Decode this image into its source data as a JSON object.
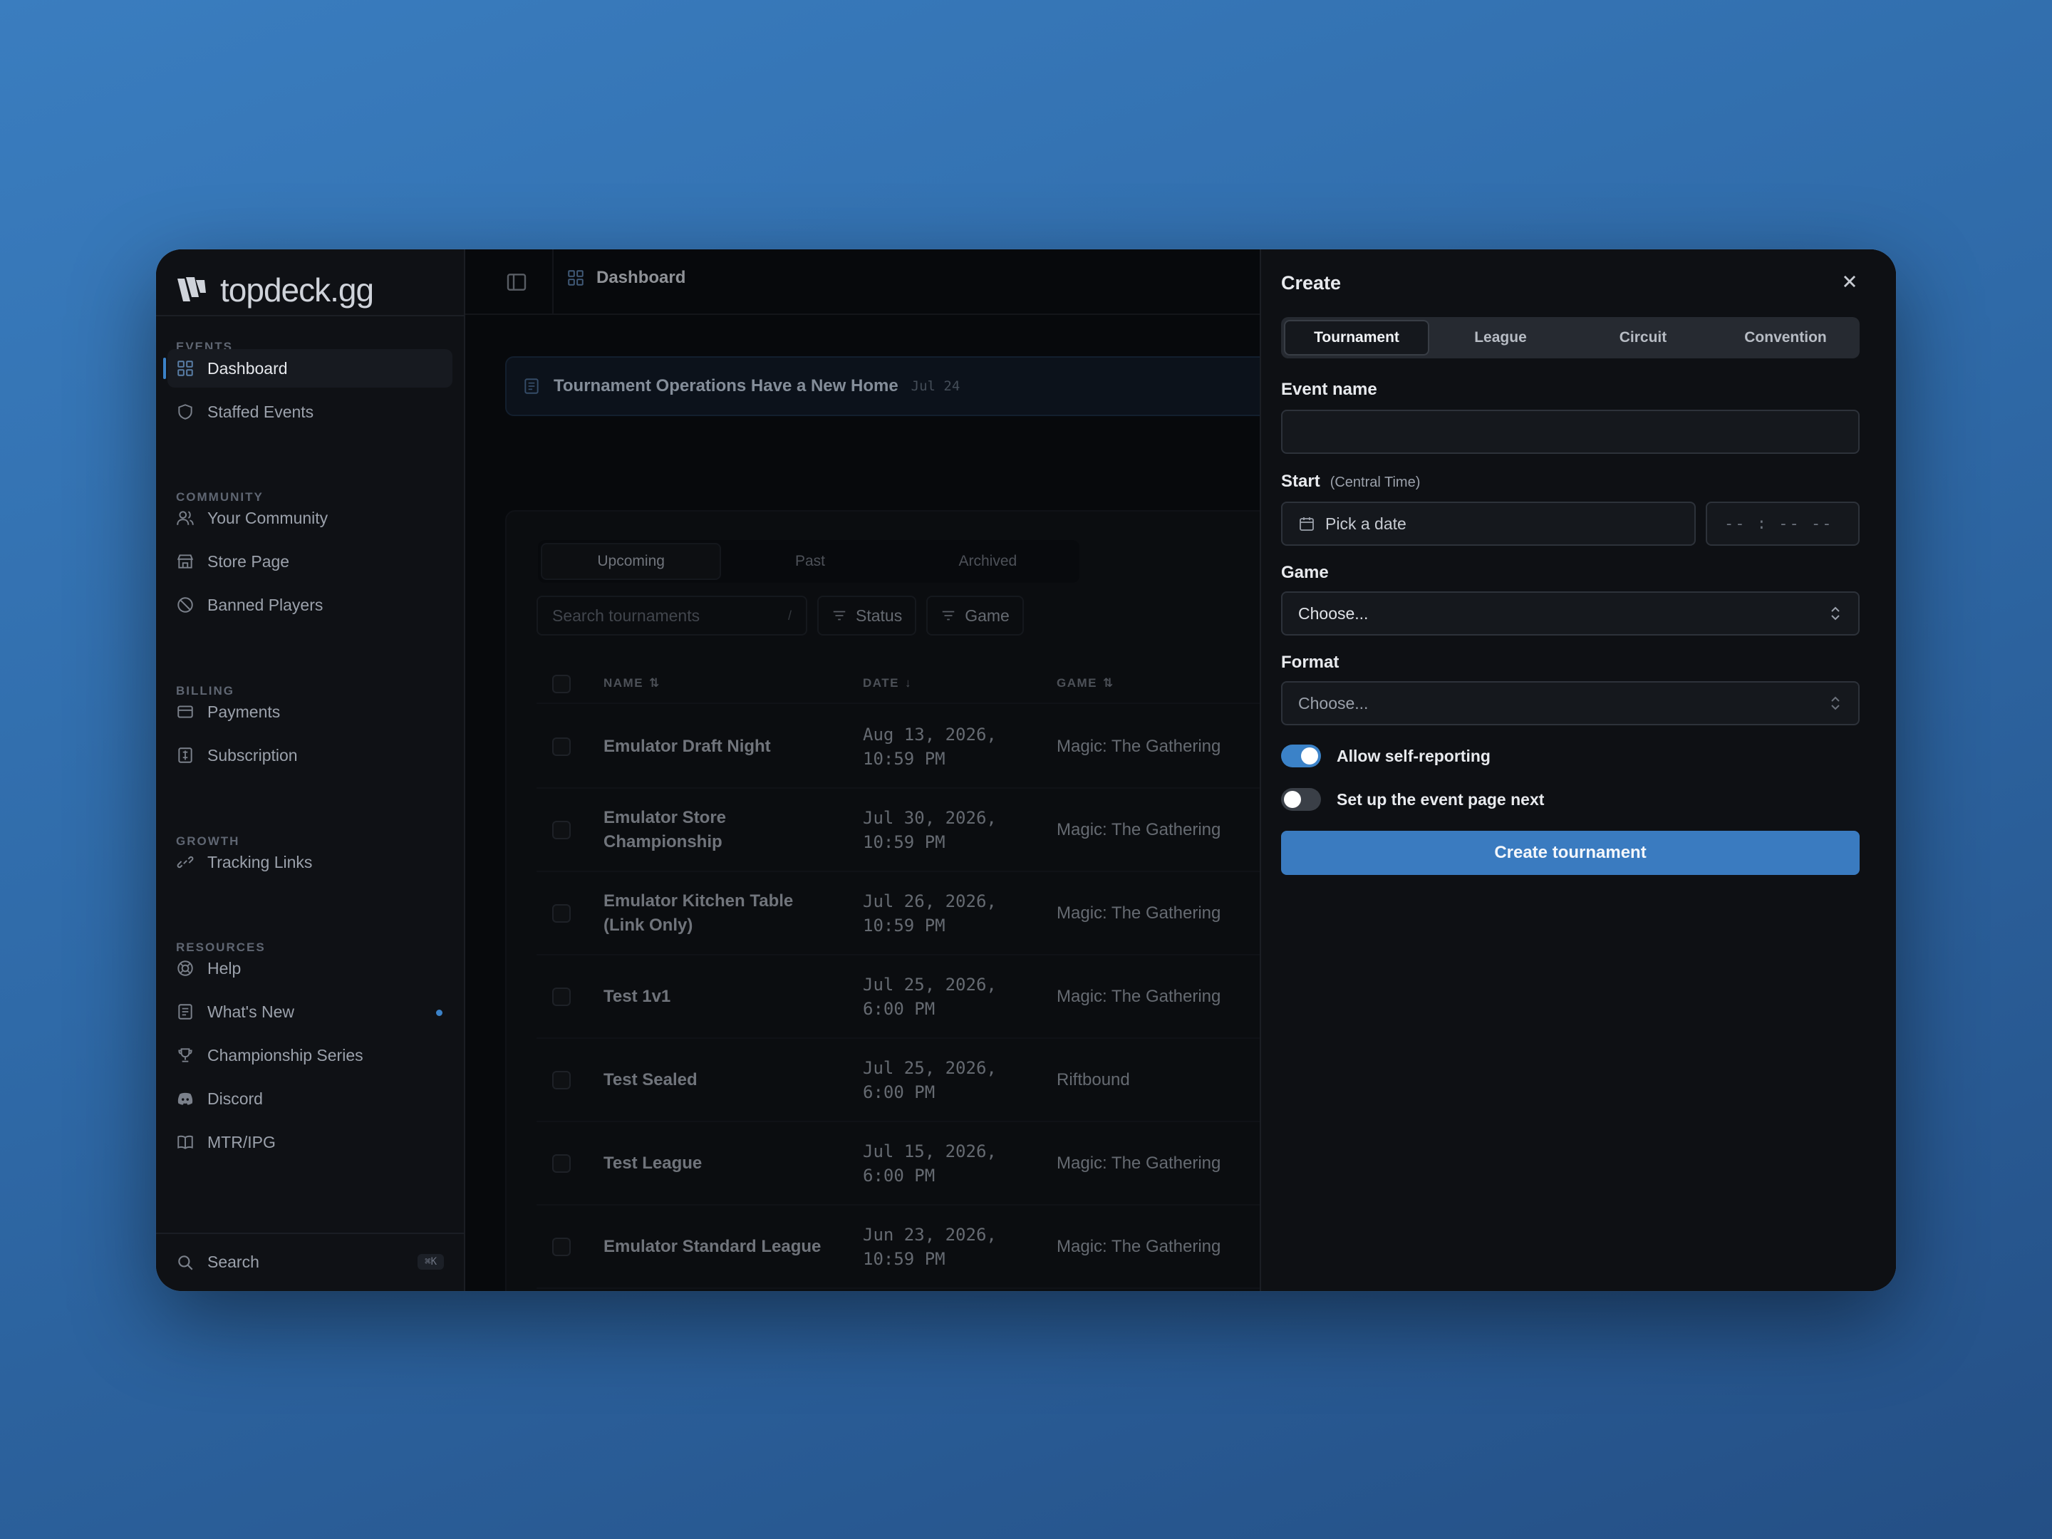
{
  "app": {
    "logo_text": "topdeck.gg"
  },
  "sidebar": {
    "sections": {
      "events": "EVENTS",
      "community": "COMMUNITY",
      "billing": "BILLING",
      "growth": "GROWTH",
      "resources": "RESOURCES"
    },
    "items": [
      {
        "label": "Dashboard",
        "icon": "grid-icon"
      },
      {
        "label": "Staffed Events",
        "icon": "shield-icon"
      },
      {
        "label": "Your Community",
        "icon": "users-icon"
      },
      {
        "label": "Store Page",
        "icon": "store-icon"
      },
      {
        "label": "Banned Players",
        "icon": "ban-icon"
      },
      {
        "label": "Payments",
        "icon": "card-icon"
      },
      {
        "label": "Subscription",
        "icon": "receipt-icon"
      },
      {
        "label": "Tracking Links",
        "icon": "link-icon"
      },
      {
        "label": "Help",
        "icon": "lifebuoy-icon"
      },
      {
        "label": "What's New",
        "icon": "newspaper-icon"
      },
      {
        "label": "Championship Series",
        "icon": "trophy-icon"
      },
      {
        "label": "Discord",
        "icon": "discord-icon"
      },
      {
        "label": "MTR/IPG",
        "icon": "book-icon"
      }
    ],
    "search_label": "Search",
    "search_shortcut": "⌘K"
  },
  "header": {
    "breadcrumb": "Dashboard"
  },
  "banner": {
    "title": "Tournament Operations Have a New Home",
    "date": "Jul 24"
  },
  "events": {
    "tabs": [
      "Upcoming",
      "Past",
      "Archived"
    ],
    "search_placeholder": "Search tournaments",
    "search_shortcut": "/",
    "filters": [
      "Status",
      "Game"
    ],
    "columns": [
      "NAME",
      "DATE",
      "GAME"
    ],
    "rows": [
      {
        "name": "Emulator Draft Night",
        "date": "Aug 13, 2026, 10:59 PM",
        "game": "Magic: The Gathering"
      },
      {
        "name": "Emulator Store Championship",
        "date": "Jul 30, 2026, 10:59 PM",
        "game": "Magic: The Gathering"
      },
      {
        "name": "Emulator Kitchen Table (Link Only)",
        "date": "Jul 26, 2026, 10:59 PM",
        "game": "Magic: The Gathering"
      },
      {
        "name": "Test 1v1",
        "date": "Jul 25, 2026, 6:00 PM",
        "game": "Magic: The Gathering"
      },
      {
        "name": "Test Sealed",
        "date": "Jul 25, 2026, 6:00 PM",
        "game": "Riftbound"
      },
      {
        "name": "Test League",
        "date": "Jul 15, 2026, 6:00 PM",
        "game": "Magic: The Gathering"
      },
      {
        "name": "Emulator Standard League",
        "date": "Jun 23, 2026, 10:59 PM",
        "game": "Magic: The Gathering"
      }
    ]
  },
  "create": {
    "title": "Create",
    "tabs": [
      "Tournament",
      "League",
      "Circuit",
      "Convention"
    ],
    "event_name_label": "Event name",
    "event_name_value": "",
    "start_label": "Start",
    "start_tz": "(Central Time)",
    "date_placeholder": "Pick a date",
    "time_placeholder": "-- : --  --",
    "game_label": "Game",
    "game_value": "Choose...",
    "format_label": "Format",
    "format_value": "Choose...",
    "self_report_label": "Allow self-reporting",
    "self_report_on": true,
    "event_page_label": "Set up the event page next",
    "event_page_on": false,
    "submit_label": "Create tournament"
  },
  "colors": {
    "accent": "#3a7bc0",
    "background": "#0b0d11"
  }
}
